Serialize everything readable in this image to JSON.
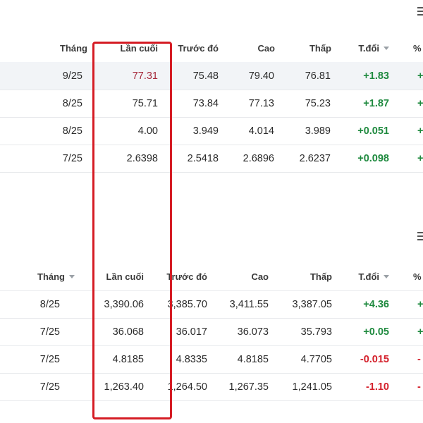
{
  "accent_colors": {
    "positive": "#1f8a3f",
    "negative": "#d4202b",
    "highlight_box": "#d51c24"
  },
  "tables": [
    {
      "headers": [
        "Tháng",
        "Lần cuối",
        "Trước đó",
        "Cao",
        "Thấp",
        "T.đổi",
        "%"
      ],
      "sort_caret_column": "T.đổi",
      "rows": [
        {
          "month": "9/25",
          "last": "77.31",
          "prev": "75.48",
          "high": "79.40",
          "low": "76.81",
          "chg": "+1.83",
          "pct": "+"
        },
        {
          "month": "8/25",
          "last": "75.71",
          "prev": "73.84",
          "high": "77.13",
          "low": "75.23",
          "chg": "+1.87",
          "pct": "+"
        },
        {
          "month": "8/25",
          "last": "4.00",
          "prev": "3.949",
          "high": "4.014",
          "low": "3.989",
          "chg": "+0.051",
          "pct": "+"
        },
        {
          "month": "7/25",
          "last": "2.6398",
          "prev": "2.5418",
          "high": "2.6896",
          "low": "2.6237",
          "chg": "+0.098",
          "pct": "+"
        }
      ]
    },
    {
      "headers": [
        "Tháng",
        "Lần cuối",
        "Trước đó",
        "Cao",
        "Thấp",
        "T.đổi",
        "%"
      ],
      "sort_caret_columns": [
        "Tháng",
        "T.đổi"
      ],
      "rows": [
        {
          "month": "8/25",
          "last": "3,390.06",
          "prev": "3,385.70",
          "high": "3,411.55",
          "low": "3,387.05",
          "chg": "+4.36",
          "pct": "+"
        },
        {
          "month": "7/25",
          "last": "36.068",
          "prev": "36.017",
          "high": "36.073",
          "low": "35.793",
          "chg": "+0.05",
          "pct": "+"
        },
        {
          "month": "7/25",
          "last": "4.8185",
          "prev": "4.8335",
          "high": "4.8185",
          "low": "4.7705",
          "chg": "-0.015",
          "pct": "-"
        },
        {
          "month": "7/25",
          "last": "1,263.40",
          "prev": "1,264.50",
          "high": "1,267.35",
          "low": "1,241.05",
          "chg": "-1.10",
          "pct": "-"
        }
      ]
    }
  ]
}
